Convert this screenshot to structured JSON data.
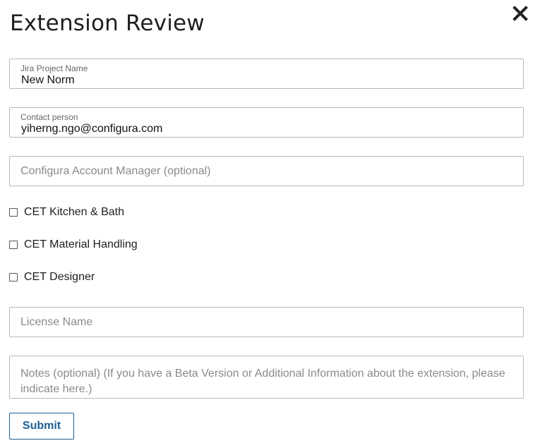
{
  "dialog": {
    "title": "Extension Review",
    "close_icon": "close-icon"
  },
  "fields": {
    "jira_project": {
      "label": "Jira Project Name",
      "value": "New Norm"
    },
    "contact_person": {
      "label": "Contact person",
      "value": "yiherng.ngo@configura.com"
    },
    "account_manager": {
      "placeholder": "Configura Account Manager (optional)",
      "value": ""
    },
    "license_name": {
      "placeholder": "License Name",
      "value": ""
    },
    "notes": {
      "placeholder": "Notes (optional) (If you have a Beta Version or Additional Information about the extension, please indicate here.)",
      "value": ""
    }
  },
  "checkboxes": [
    {
      "label": "CET Kitchen & Bath",
      "checked": false
    },
    {
      "label": "CET Material Handling",
      "checked": false
    },
    {
      "label": "CET Designer",
      "checked": false
    }
  ],
  "actions": {
    "submit_label": "Submit"
  },
  "colors": {
    "accent": "#1f5f96",
    "border": "#b9b9b9",
    "placeholder": "#8a8a8a"
  }
}
